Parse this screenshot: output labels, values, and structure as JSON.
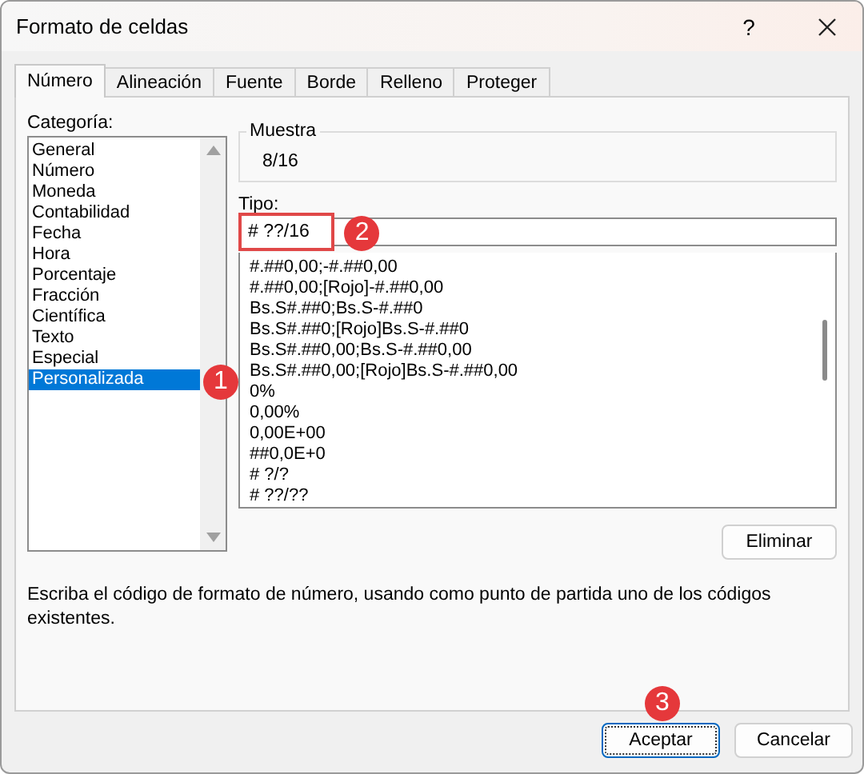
{
  "window": {
    "title": "Formato de celdas",
    "help": "?"
  },
  "tabs": [
    {
      "label": "Número",
      "selected": true
    },
    {
      "label": "Alineación",
      "selected": false
    },
    {
      "label": "Fuente",
      "selected": false
    },
    {
      "label": "Borde",
      "selected": false
    },
    {
      "label": "Relleno",
      "selected": false
    },
    {
      "label": "Proteger",
      "selected": false
    }
  ],
  "category": {
    "label": "Categoría:",
    "items": [
      {
        "label": "General",
        "selected": false
      },
      {
        "label": "Número",
        "selected": false
      },
      {
        "label": "Moneda",
        "selected": false
      },
      {
        "label": "Contabilidad",
        "selected": false
      },
      {
        "label": "Fecha",
        "selected": false
      },
      {
        "label": "Hora",
        "selected": false
      },
      {
        "label": "Porcentaje",
        "selected": false
      },
      {
        "label": "Fracción",
        "selected": false
      },
      {
        "label": "Científica",
        "selected": false
      },
      {
        "label": "Texto",
        "selected": false
      },
      {
        "label": "Especial",
        "selected": false
      },
      {
        "label": "Personalizada",
        "selected": true
      }
    ],
    "callout": "1"
  },
  "sample": {
    "label": "Muestra",
    "value": "8/16"
  },
  "type": {
    "label": "Tipo:",
    "value": "# ??/16",
    "highlighted": true,
    "callout": "2",
    "items": [
      "#.##0,00;-#.##0,00",
      "#.##0,00;[Rojo]-#.##0,00",
      "Bs.S#.##0;Bs.S-#.##0",
      "Bs.S#.##0;[Rojo]Bs.S-#.##0",
      "Bs.S#.##0,00;Bs.S-#.##0,00",
      "Bs.S#.##0,00;[Rojo]Bs.S-#.##0,00",
      "0%",
      "0,00%",
      "0,00E+00",
      "##0,0E+0",
      "# ?/?",
      "# ??/??"
    ]
  },
  "delete_button": "Eliminar",
  "description": "Escriba el código de formato de número, usando como punto de partida uno de los códigos existentes.",
  "buttons": [
    {
      "label": "Aceptar",
      "default": true,
      "callout": "3"
    },
    {
      "label": "Cancelar",
      "default": false
    }
  ]
}
